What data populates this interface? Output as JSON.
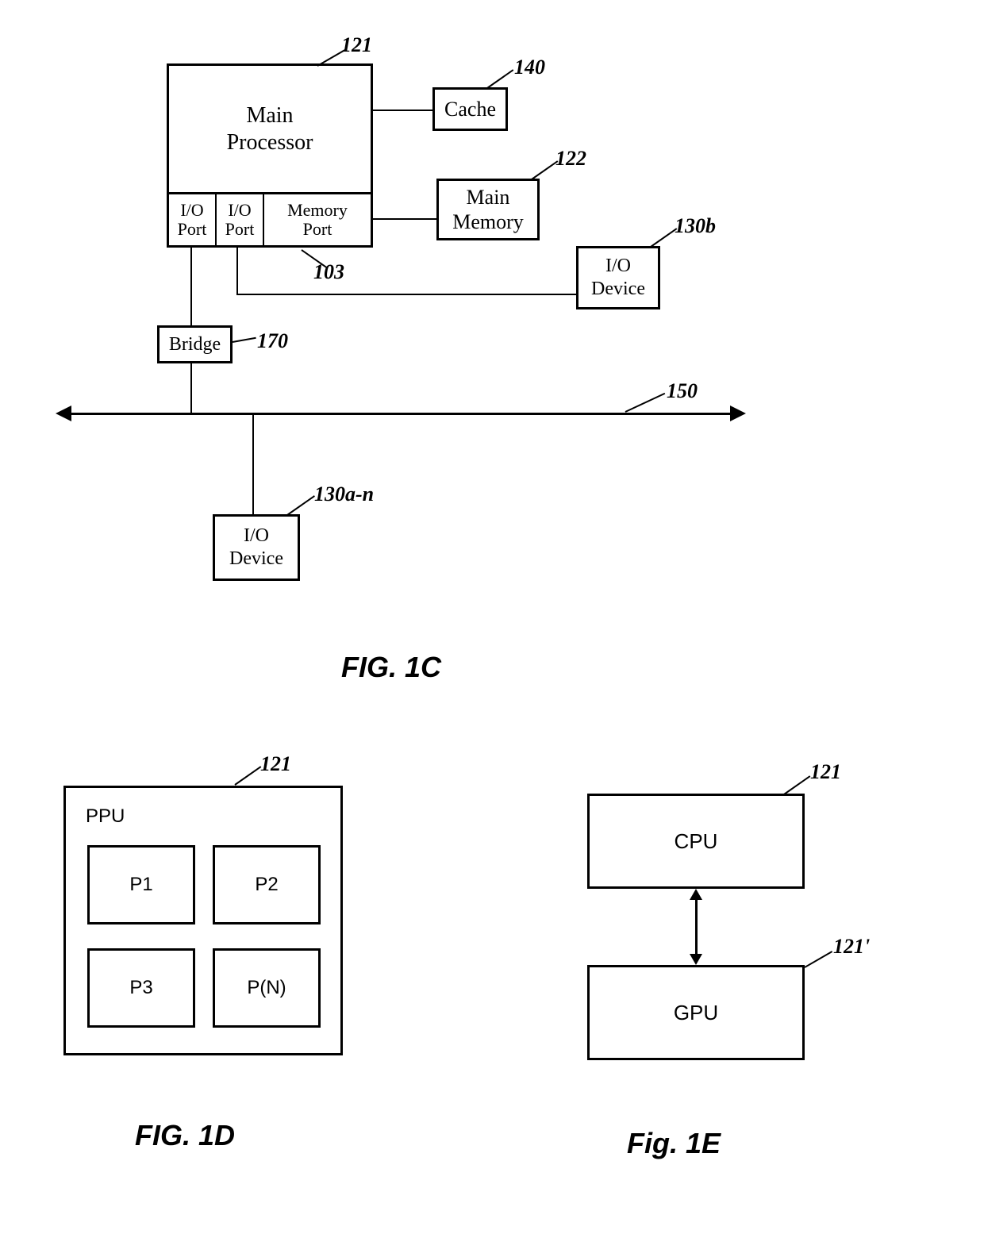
{
  "fig1c": {
    "mainProcessor": "Main\nProcessor",
    "cache": "Cache",
    "mainMemory": "Main\nMemory",
    "bridge": "Bridge",
    "ioPort": "I/O\nPort",
    "memoryPort": "Memory\nPort",
    "ioDevice": "I/O\nDevice",
    "labels": {
      "mainProcessor": "121",
      "cache": "140",
      "mainMemory": "122",
      "memoryPort": "103",
      "ioDeviceRight": "130b",
      "bridge": "170",
      "bus": "150",
      "ioDeviceBottom": "130a-n"
    },
    "title": "FIG. 1C"
  },
  "fig1d": {
    "ppu": "PPU",
    "cells": [
      "P1",
      "P2",
      "P3",
      "P(N)"
    ],
    "label": "121",
    "title": "FIG. 1D"
  },
  "fig1e": {
    "cpu": "CPU",
    "gpu": "GPU",
    "cpuLabel": "121",
    "gpuLabel": "121'",
    "title": "Fig. 1E"
  }
}
